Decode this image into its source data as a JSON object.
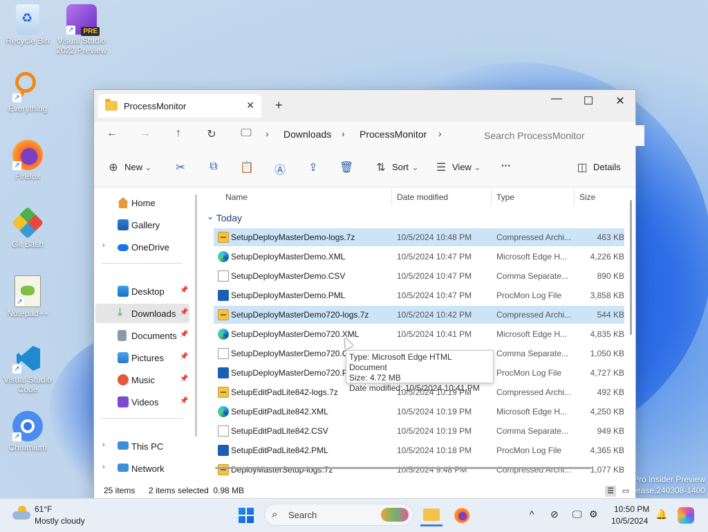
{
  "desktop": {
    "icons": [
      {
        "label": "Recycle Bin"
      },
      {
        "label": "Visual Studio 2022 Preview",
        "badge": "PRE"
      },
      {
        "label": "Everything"
      },
      {
        "label": "Firefox"
      },
      {
        "label": "Git Bash"
      },
      {
        "label": "Notepad++"
      },
      {
        "label": "Visual Studio Code"
      },
      {
        "label": "Chromium"
      }
    ],
    "watermark_line1": "Pro Insider Preview",
    "watermark_line2": "elease.240308-1400"
  },
  "window": {
    "tab_title": "ProcessMonitor",
    "tab_close": "✕",
    "new_tab": "+",
    "minimize": "—",
    "maximize": "☐",
    "close": "✕",
    "nav": {
      "back": "←",
      "forward": "→",
      "up": "↑",
      "refresh": "↻",
      "monitor": "🖵"
    },
    "breadcrumb": [
      "Downloads",
      "ProcessMonitor"
    ],
    "breadcrumb_sep": "›",
    "search_placeholder": "Search ProcessMonitor",
    "toolbar": {
      "new_label": "New",
      "sort_label": "Sort",
      "view_label": "View",
      "more_label": "···",
      "details_label": "Details"
    },
    "sidebar": {
      "items": [
        {
          "label": "Home"
        },
        {
          "label": "Gallery"
        },
        {
          "label": "OneDrive"
        },
        {
          "label": "Desktop"
        },
        {
          "label": "Downloads"
        },
        {
          "label": "Documents"
        },
        {
          "label": "Pictures"
        },
        {
          "label": "Music"
        },
        {
          "label": "Videos"
        },
        {
          "label": "This PC"
        },
        {
          "label": "Network"
        }
      ],
      "chevron": "›",
      "pin": "📌"
    },
    "columns": {
      "name": "Name",
      "date": "Date modified",
      "type": "Type",
      "size": "Size"
    },
    "group_label": "Today",
    "group_chevron": "⌄",
    "files": [
      {
        "name": "SetupDeployMasterDemo-logs.7z",
        "date": "10/5/2024 10:48 PM",
        "type": "Compressed Archi...",
        "size": "463 KB",
        "kind": "7z",
        "selected": true
      },
      {
        "name": "SetupDeployMasterDemo.XML",
        "date": "10/5/2024 10:47 PM",
        "type": "Microsoft Edge H...",
        "size": "4,226 KB",
        "kind": "edge",
        "selected": false
      },
      {
        "name": "SetupDeployMasterDemo.CSV",
        "date": "10/5/2024 10:47 PM",
        "type": "Comma Separate...",
        "size": "890 KB",
        "kind": "csv",
        "selected": false
      },
      {
        "name": "SetupDeployMasterDemo.PML",
        "date": "10/5/2024 10:47 PM",
        "type": "ProcMon Log File",
        "size": "3,858 KB",
        "kind": "pml",
        "selected": false
      },
      {
        "name": "SetupDeployMasterDemo720-logs.7z",
        "date": "10/5/2024 10:42 PM",
        "type": "Compressed Archi...",
        "size": "544 KB",
        "kind": "7z",
        "selected": true
      },
      {
        "name": "SetupDeployMasterDemo720.XML",
        "date": "10/5/2024 10:41 PM",
        "type": "Microsoft Edge H...",
        "size": "4,835 KB",
        "kind": "edge",
        "selected": false
      },
      {
        "name": "SetupDeployMasterDemo720.C",
        "date": "",
        "type": "Comma Separate...",
        "size": "1,050 KB",
        "kind": "csv",
        "selected": false
      },
      {
        "name": "SetupDeployMasterDemo720.P",
        "date": "",
        "type": "ProcMon Log File",
        "size": "4,727 KB",
        "kind": "pml",
        "selected": false
      },
      {
        "name": "SetupEditPadLite842-logs.7z",
        "date": "10/5/2024 10:19 PM",
        "type": "Compressed Archi...",
        "size": "492 KB",
        "kind": "7z",
        "selected": false
      },
      {
        "name": "SetupEditPadLite842.XML",
        "date": "10/5/2024 10:19 PM",
        "type": "Microsoft Edge H...",
        "size": "4,250 KB",
        "kind": "edge",
        "selected": false
      },
      {
        "name": "SetupEditPadLite842.CSV",
        "date": "10/5/2024 10:19 PM",
        "type": "Comma Separate...",
        "size": "949 KB",
        "kind": "csv",
        "selected": false
      },
      {
        "name": "SetupEditPadLite842.PML",
        "date": "10/5/2024 10:18 PM",
        "type": "ProcMon Log File",
        "size": "4,365 KB",
        "kind": "pml",
        "selected": false
      },
      {
        "name": "DeployMasterSetup-logs.7z",
        "date": "10/5/2024 9:48 PM",
        "type": "Compressed Archi...",
        "size": "1,077 KB",
        "kind": "7z",
        "selected": false
      }
    ],
    "tooltip": {
      "type_line": "Type: Microsoft Edge HTML Document",
      "size_line": "Size: 4.72 MB",
      "date_line": "Date modified: 10/5/2024 10:41 PM"
    },
    "status": {
      "items": "25 items",
      "selected": "2 items selected  0.98 MB"
    }
  },
  "taskbar": {
    "temperature": "61°F",
    "condition": "Mostly cloudy",
    "search_label": "Search",
    "time": "10:50 PM",
    "date": "10/5/2024",
    "tray_chevron": "^"
  },
  "colors": {
    "accent": "#0067c0",
    "selection": "#cce4f7",
    "folder": "#f4c44a"
  }
}
